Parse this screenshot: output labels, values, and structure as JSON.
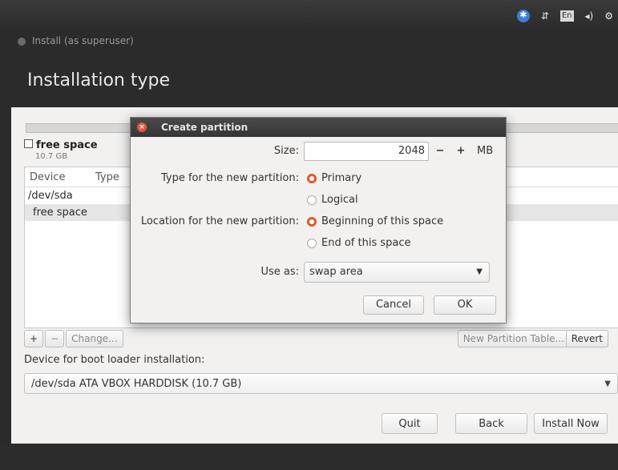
{
  "window": {
    "title": "Install (as superuser)",
    "page_title": "Installation type"
  },
  "tray": {
    "accessibility": "✱",
    "network": "⇵",
    "lang": "En",
    "volume": "◂)",
    "power": "⚙"
  },
  "free_space": {
    "label": "free space",
    "size": "10.7 GB"
  },
  "table": {
    "headers": [
      "Device",
      "Type"
    ],
    "rows": [
      "/dev/sda",
      "free space"
    ]
  },
  "table_tools": {
    "add": "+",
    "remove": "−",
    "change": "Change...",
    "new_table": "New Partition Table...",
    "revert": "Revert"
  },
  "boot": {
    "label": "Device for boot loader installation:",
    "value": "/dev/sda ATA VBOX HARDDISK (10.7 GB)"
  },
  "nav": {
    "quit": "Quit",
    "back": "Back",
    "install": "Install Now"
  },
  "dialog": {
    "title": "Create partition",
    "size_label": "Size:",
    "size_value": "2048",
    "minus": "−",
    "plus": "+",
    "unit": "MB",
    "type_label": "Type for the new partition:",
    "type_options": [
      "Primary",
      "Logical"
    ],
    "type_selected": "Primary",
    "location_label": "Location for the new partition:",
    "location_options": [
      "Beginning of this space",
      "End of this space"
    ],
    "location_selected": "Beginning of this space",
    "use_label": "Use as:",
    "use_value": "swap area",
    "cancel": "Cancel",
    "ok": "OK"
  },
  "colors": {
    "radio_accent": "#e05a2b",
    "close_button": "#e2583e",
    "accessibility": "#3d7ed6"
  }
}
